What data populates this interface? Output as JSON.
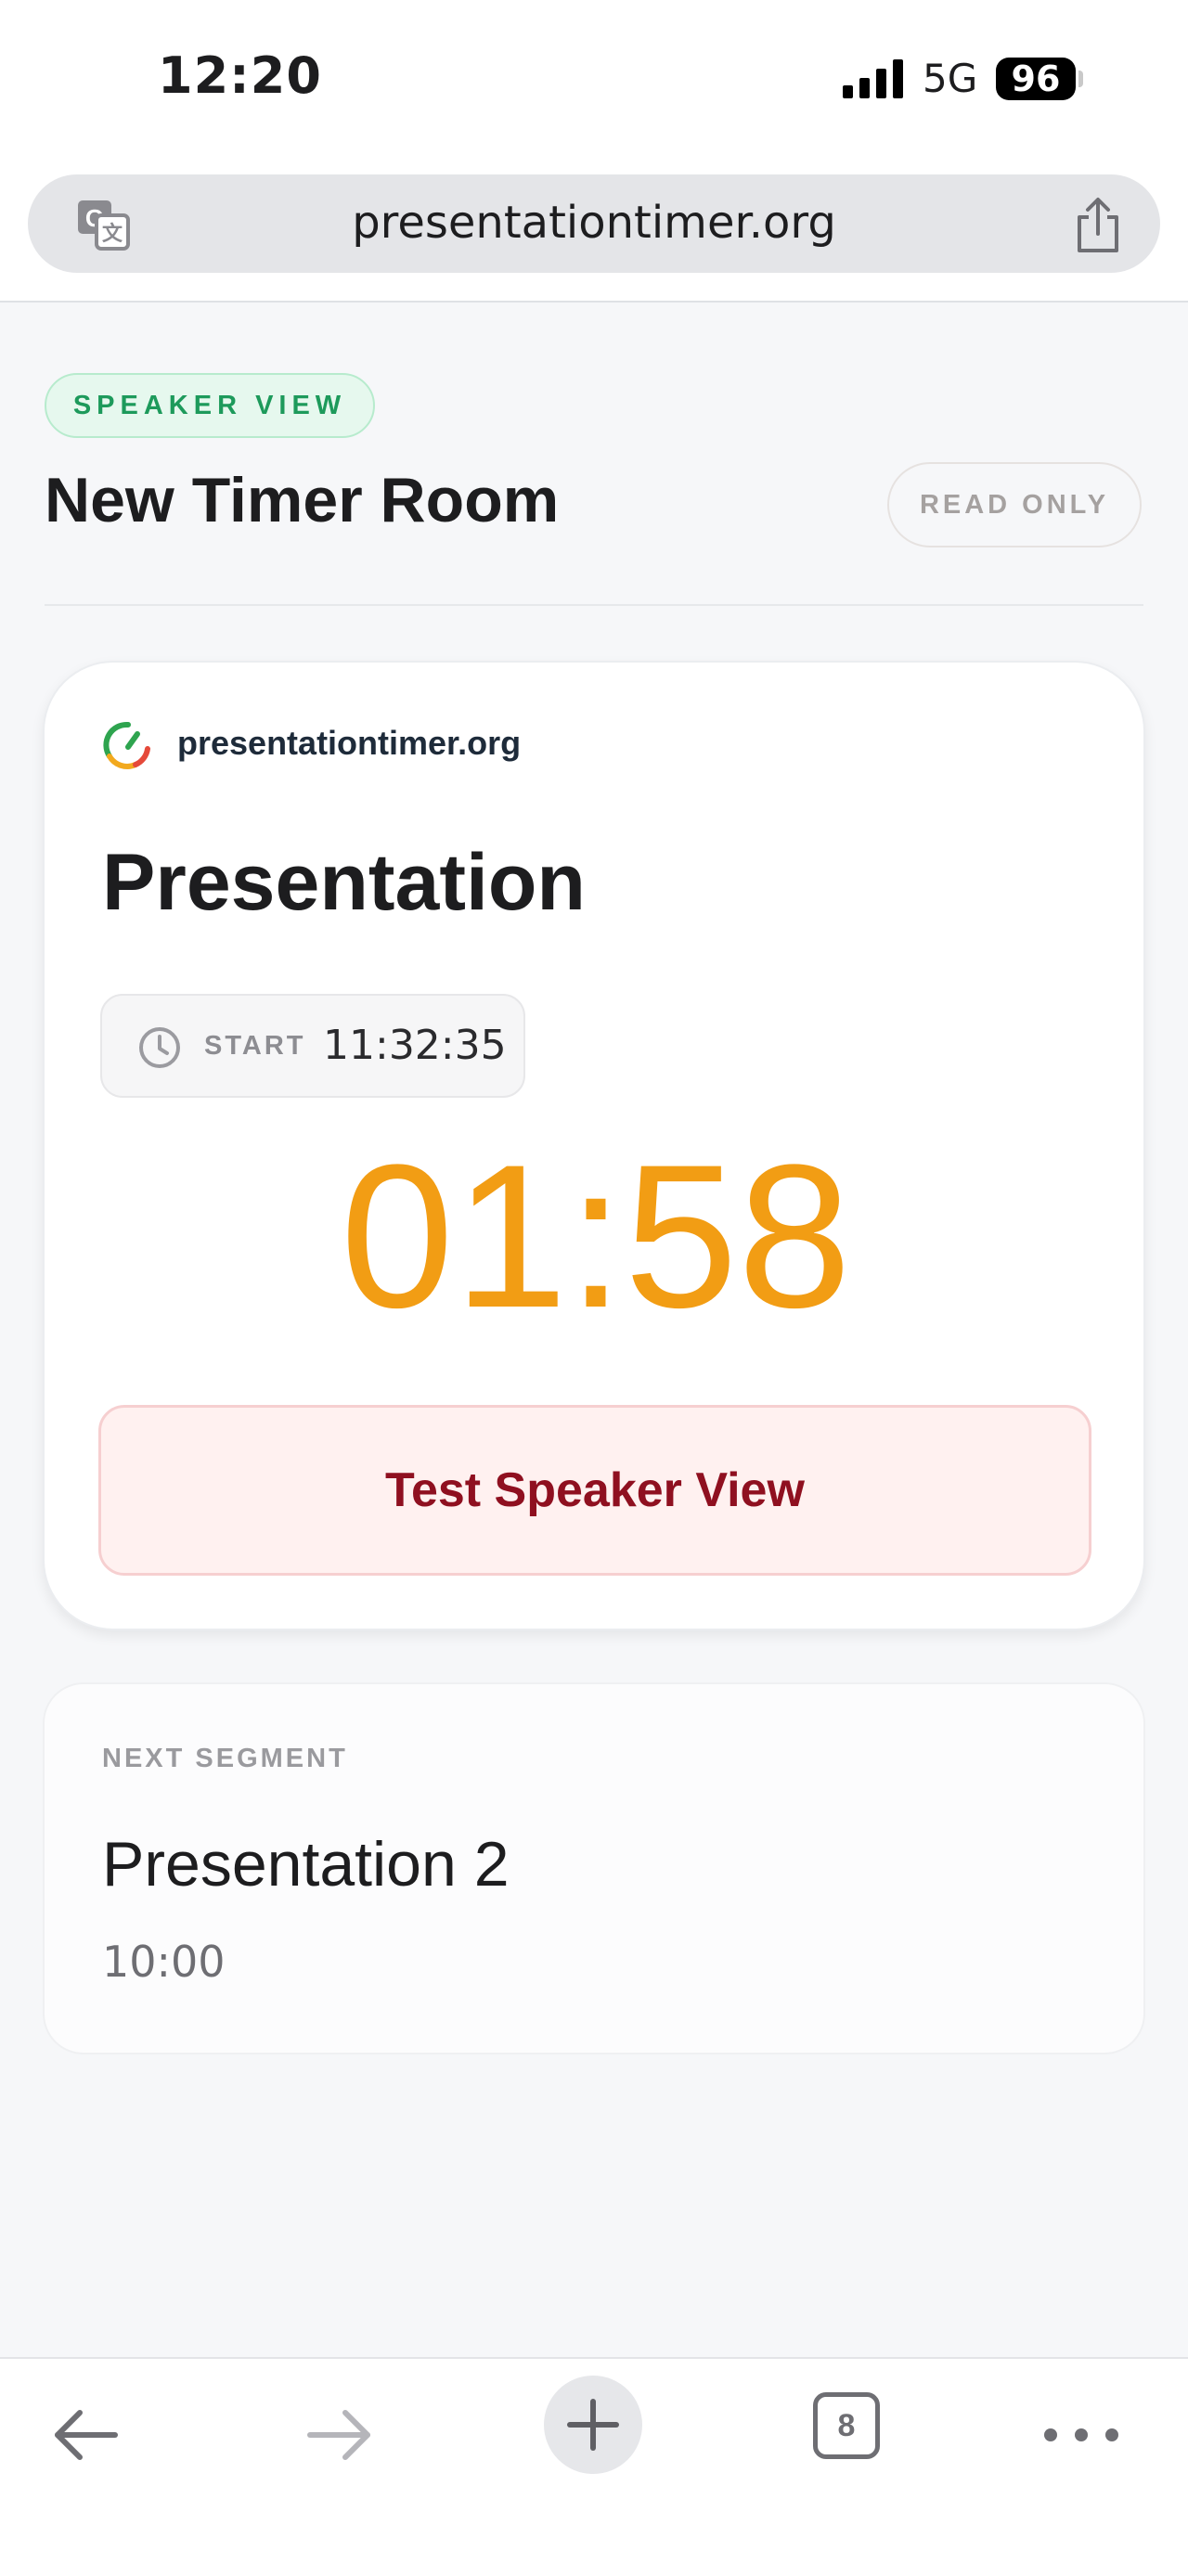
{
  "status_bar": {
    "time": "12:20",
    "network": "5G",
    "battery": "96"
  },
  "browser": {
    "url": "presentationtimer.org",
    "open_tabs": "8"
  },
  "page": {
    "view_badge": "SPEAKER VIEW",
    "room_title": "New Timer Room",
    "mode_badge": "READ ONLY"
  },
  "current": {
    "brand": "presentationtimer.org",
    "segment_title": "Presentation",
    "start_label": "START",
    "start_time": "11:32:35",
    "countdown": "01:58",
    "countdown_color": "#f29d14",
    "test_button_label": "Test Speaker View"
  },
  "next": {
    "label": "NEXT SEGMENT",
    "title": "Presentation 2",
    "duration": "10:00"
  },
  "icons": {
    "translate": "translate-icon",
    "share": "share-icon",
    "clock": "clock-icon",
    "back": "arrow-left-icon",
    "forward": "arrow-right-icon",
    "new_tab": "plus-icon",
    "more": "ellipsis-icon"
  }
}
